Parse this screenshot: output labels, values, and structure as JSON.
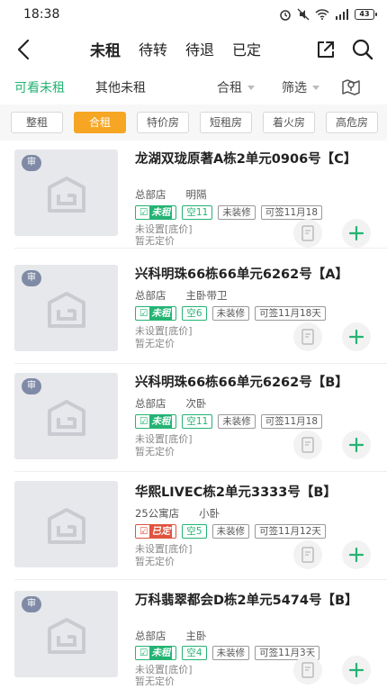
{
  "status_bar": {
    "time": "18:38",
    "battery": "43"
  },
  "nav": {
    "tabs": [
      "未租",
      "待转",
      "待退",
      "已定"
    ]
  },
  "sub_tabs": {
    "viewable": "可看未租",
    "other": "其他未租"
  },
  "filters": {
    "rent_type": "合租",
    "screen": "筛选"
  },
  "chips": [
    "整租",
    "合租",
    "特价房",
    "短租房",
    "着火房",
    "高危房"
  ],
  "listings": [
    {
      "badge": "审",
      "title": "龙湖双珑原著A栋2单元0906号【C】",
      "store": "总部店",
      "room": "明隔",
      "status": "未租",
      "vacant": "空11",
      "decor": "未装修",
      "sign": "可签11月18",
      "price_note": "未设置[底价]",
      "pricing": "暂无定价"
    },
    {
      "badge": "审",
      "title": "兴科明珠66栋66单元6262号【A】",
      "store": "总部店",
      "room": "主卧带卫",
      "status": "未租",
      "vacant": "空6",
      "decor": "未装修",
      "sign": "可签11月18天",
      "price_note": "未设置[底价]",
      "pricing": "暂无定价"
    },
    {
      "badge": "审",
      "title": "兴科明珠66栋66单元6262号【B】",
      "store": "总部店",
      "room": "次卧",
      "status": "未租",
      "vacant": "空11",
      "decor": "未装修",
      "sign": "可签11月18",
      "price_note": "未设置[底价]",
      "pricing": "暂无定价"
    },
    {
      "badge": "",
      "title": "华熙LIVEC栋2单元3333号【B】",
      "store": "25公寓店",
      "room": "小卧",
      "status": "已定",
      "vacant": "空5",
      "decor": "未装修",
      "sign": "可签11月12天",
      "price_note": "未设置[底价]",
      "pricing": "暂无定价"
    },
    {
      "badge": "审",
      "title": "万科翡翠都会D栋2单元5474号【B】",
      "store": "总部店",
      "room": "主卧",
      "status": "未租",
      "vacant": "空4",
      "decor": "未装修",
      "sign": "可签11月3天",
      "price_note": "未设置[底价]",
      "pricing": "暂无定价"
    }
  ],
  "colors": {
    "accent": "#24b373",
    "chip_active": "#f6a623",
    "booked": "#e0533e"
  },
  "icons": [
    "back-icon",
    "share-icon",
    "search-icon",
    "map-pin-icon",
    "placeholder-logo-icon",
    "document-icon",
    "plus-icon"
  ]
}
